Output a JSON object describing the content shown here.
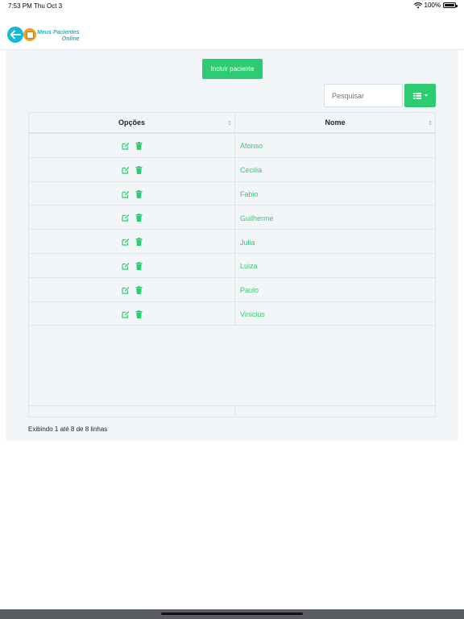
{
  "status_bar": {
    "time": "7:53 PM",
    "date": "Thu Oct 3",
    "battery": "100%"
  },
  "header": {
    "brand_line1": "Meus Pacientes",
    "brand_line2": "Online"
  },
  "toolbar": {
    "include_label": "Incluir paciente",
    "search_placeholder": "Pesquisar"
  },
  "table": {
    "columns": [
      "Opções",
      "Nome"
    ],
    "rows": [
      {
        "name": "Afonso"
      },
      {
        "name": "Cecilia"
      },
      {
        "name": "Fabio"
      },
      {
        "name": "Guilherme"
      },
      {
        "name": "Julia"
      },
      {
        "name": "Luiza"
      },
      {
        "name": "Paulo"
      },
      {
        "name": "Vinicius"
      }
    ]
  },
  "pagination": {
    "info": "Exibindo 1 até 8 de 8 linhas"
  },
  "colors": {
    "accent": "#2ecc71",
    "brand": "#13b8d6",
    "background": "#f3f6f9"
  },
  "icons": {
    "back": "arrow-left-icon",
    "edit": "edit-icon",
    "delete": "trash-icon",
    "view": "grid-icon"
  }
}
